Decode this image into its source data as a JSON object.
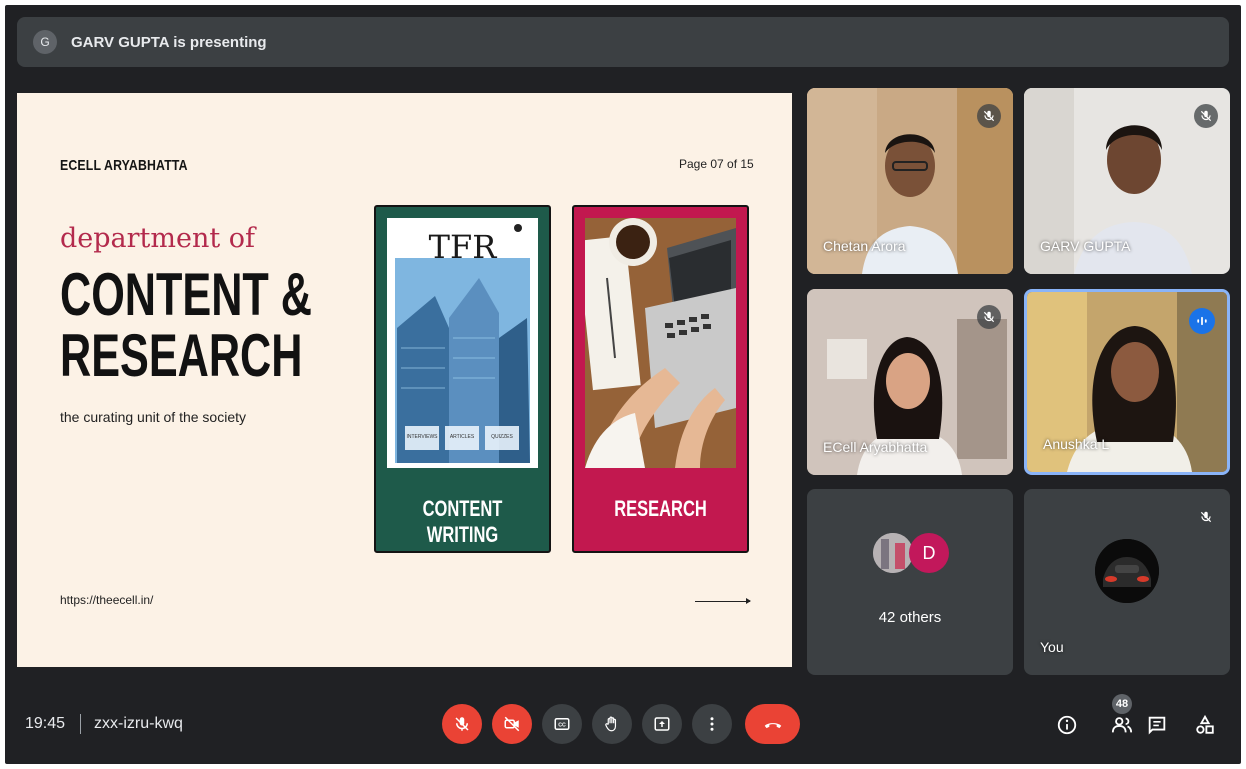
{
  "banner": {
    "avatar_initial": "G",
    "text": "GARV GUPTA is presenting"
  },
  "slide": {
    "brand": "ECELL ARYABHATTA",
    "page": "Page 07 of 15",
    "dept_line": "department of",
    "title_line1": "CONTENT &",
    "title_line2": "RESEARCH",
    "subtitle": "the curating unit of the society",
    "url": "https://theecell.in/",
    "cards": [
      {
        "label": "CONTENT WRITING",
        "magazine_title": "TFR",
        "tags": [
          "INTERVIEWS",
          "ARTICLES",
          "QUIZZES"
        ]
      },
      {
        "label": "RESEARCH"
      }
    ]
  },
  "participants": [
    {
      "name": "Chetan Arora",
      "muted": true
    },
    {
      "name": "GARV GUPTA",
      "muted": true
    },
    {
      "name": "ECell Aryabhatta",
      "muted": true
    },
    {
      "name": "Anushka L",
      "speaking": true
    },
    {
      "name": "42 others",
      "avatar_initial": "D"
    },
    {
      "name": "You",
      "muted": true
    }
  ],
  "bottom": {
    "time": "19:45",
    "meeting_code": "zxx-izru-kwq",
    "people_count": "48"
  },
  "colors": {
    "bg": "#202124",
    "tile": "#3c4043",
    "red": "#ea4335",
    "blue": "#1a73e8",
    "card_green": "#1e5a4a",
    "card_red": "#c2184f"
  },
  "icons": [
    "mic-off-icon",
    "camera-off-icon",
    "captions-icon",
    "raise-hand-icon",
    "present-icon",
    "more-icon",
    "end-call-icon",
    "info-icon",
    "people-icon",
    "chat-icon",
    "activities-icon"
  ]
}
